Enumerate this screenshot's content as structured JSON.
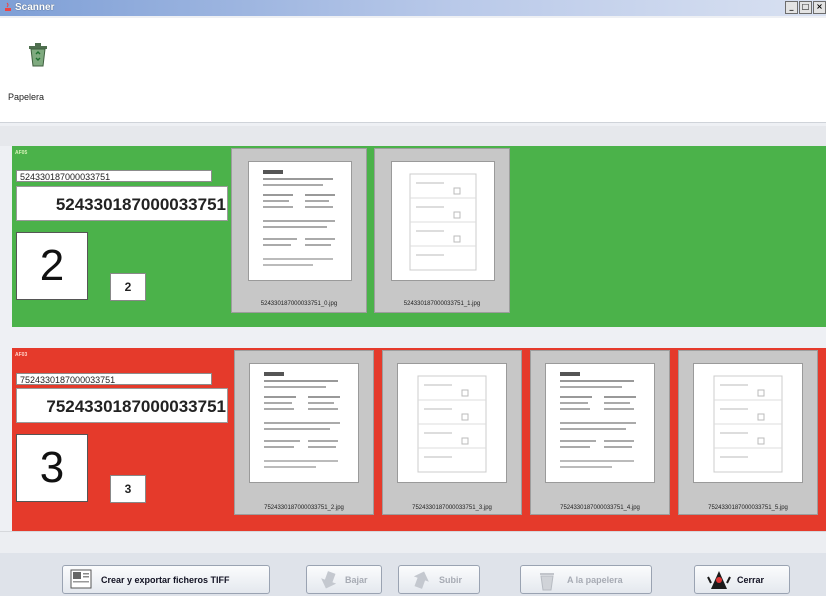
{
  "window": {
    "title": "Scanner",
    "buttons": {
      "minimize": "_",
      "maximize": "□",
      "close": "×"
    }
  },
  "toolbar": {
    "trash_label": "Papelera"
  },
  "groups": [
    {
      "label": "AF05",
      "code_small": "524330187000033751",
      "code_big": "524330187000033751",
      "count_big": "2",
      "count_small": "2",
      "color": "#4bb24a",
      "thumbnails": [
        {
          "filename": "524330187000033751_0.jpg"
        },
        {
          "filename": "524330187000033751_1.jpg"
        }
      ]
    },
    {
      "label": "AF03",
      "code_small": "7524330187000033751",
      "code_big": "7524330187000033751",
      "count_big": "3",
      "count_small": "3",
      "color": "#e53a2b",
      "thumbnails": [
        {
          "filename": "7524330187000033751_2.jpg"
        },
        {
          "filename": "7524330187000033751_3.jpg"
        },
        {
          "filename": "7524330187000033751_4.jpg"
        },
        {
          "filename": "7524330187000033751_5.jpg"
        }
      ]
    }
  ],
  "bottom_buttons": {
    "export": "Crear y exportar ficheros TIFF",
    "down": "Bajar",
    "up": "Subir",
    "to_trash": "A la papelera",
    "close": "Cerrar"
  }
}
